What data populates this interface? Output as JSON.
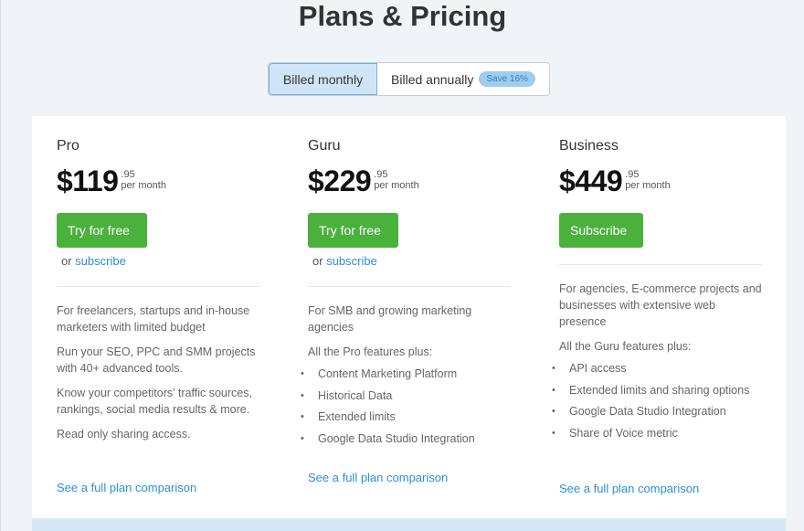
{
  "header": {
    "title": "Plans & Pricing"
  },
  "billing": {
    "monthly_label": "Billed monthly",
    "annual_label": "Billed annually",
    "save_badge": "Save 16%",
    "selected": "monthly"
  },
  "plans": [
    {
      "name": "Pro",
      "price": "$119",
      "cents": ".95",
      "period": "per month",
      "cta_label": "Try for free",
      "or_text": "or",
      "subscribe_link": "subscribe",
      "paragraphs": [
        "For freelancers, startups and in-house marketers with limited budget",
        "Run your SEO, PPC and SMM projects with 40+ advanced tools.",
        "Know your competitors’ traffic sources, rankings, social media results & more.",
        "Read only sharing access."
      ],
      "features": [],
      "compare_link": "See a full plan comparison"
    },
    {
      "name": "Guru",
      "price": "$229",
      "cents": ".95",
      "period": "per month",
      "cta_label": "Try for free",
      "or_text": "or",
      "subscribe_link": "subscribe",
      "paragraphs": [
        "For SMB and growing marketing agencies",
        "All the Pro features plus:"
      ],
      "features": [
        "Content Marketing Platform",
        "Historical Data",
        "Extended limits",
        "Google Data Studio Integration"
      ],
      "compare_link": "See a full plan comparison"
    },
    {
      "name": "Business",
      "price": "$449",
      "cents": ".95",
      "period": "per month",
      "cta_label": "Subscribe",
      "paragraphs": [
        "For agencies, E-commerce projects and businesses with extensive web presence",
        "All the Guru features plus:"
      ],
      "features": [
        "API access",
        "Extended limits and sharing options",
        "Google Data Studio Integration",
        "Share of Voice metric"
      ],
      "compare_link": "See a full plan comparison"
    }
  ],
  "colors": {
    "cta_green": "#4ab13d",
    "link_blue": "#2d8fd5",
    "toggle_active_bg": "#cfe5f7",
    "badge_bg": "#9fcdf0"
  }
}
